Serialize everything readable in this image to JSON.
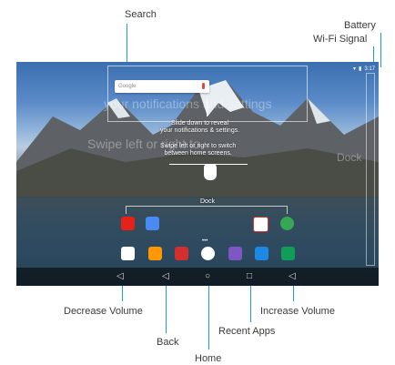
{
  "callouts": {
    "search": "Search",
    "battery": "Battery",
    "wifi": "Wi-Fi Signal",
    "decrease_volume": "Decrease Volume",
    "back": "Back",
    "home": "Home",
    "recent_apps": "Recent Apps",
    "increase_volume": "Increase Volume"
  },
  "screen": {
    "search_brand": "Google",
    "ghost_notifications": "your notifications and settings",
    "ghost_swipe": "Swipe left or right to",
    "ghost_dock": "Dock",
    "hint_slide": "Slide down to reveal",
    "hint_slide_2": "your notifications & settings.",
    "hint_swipe": "Swipe left or right to switch",
    "hint_swipe_2": "between home screens.",
    "hint_dock": "Dock",
    "status_time": "3:17"
  },
  "colors": {
    "callout_line": "#1aa1c9"
  }
}
